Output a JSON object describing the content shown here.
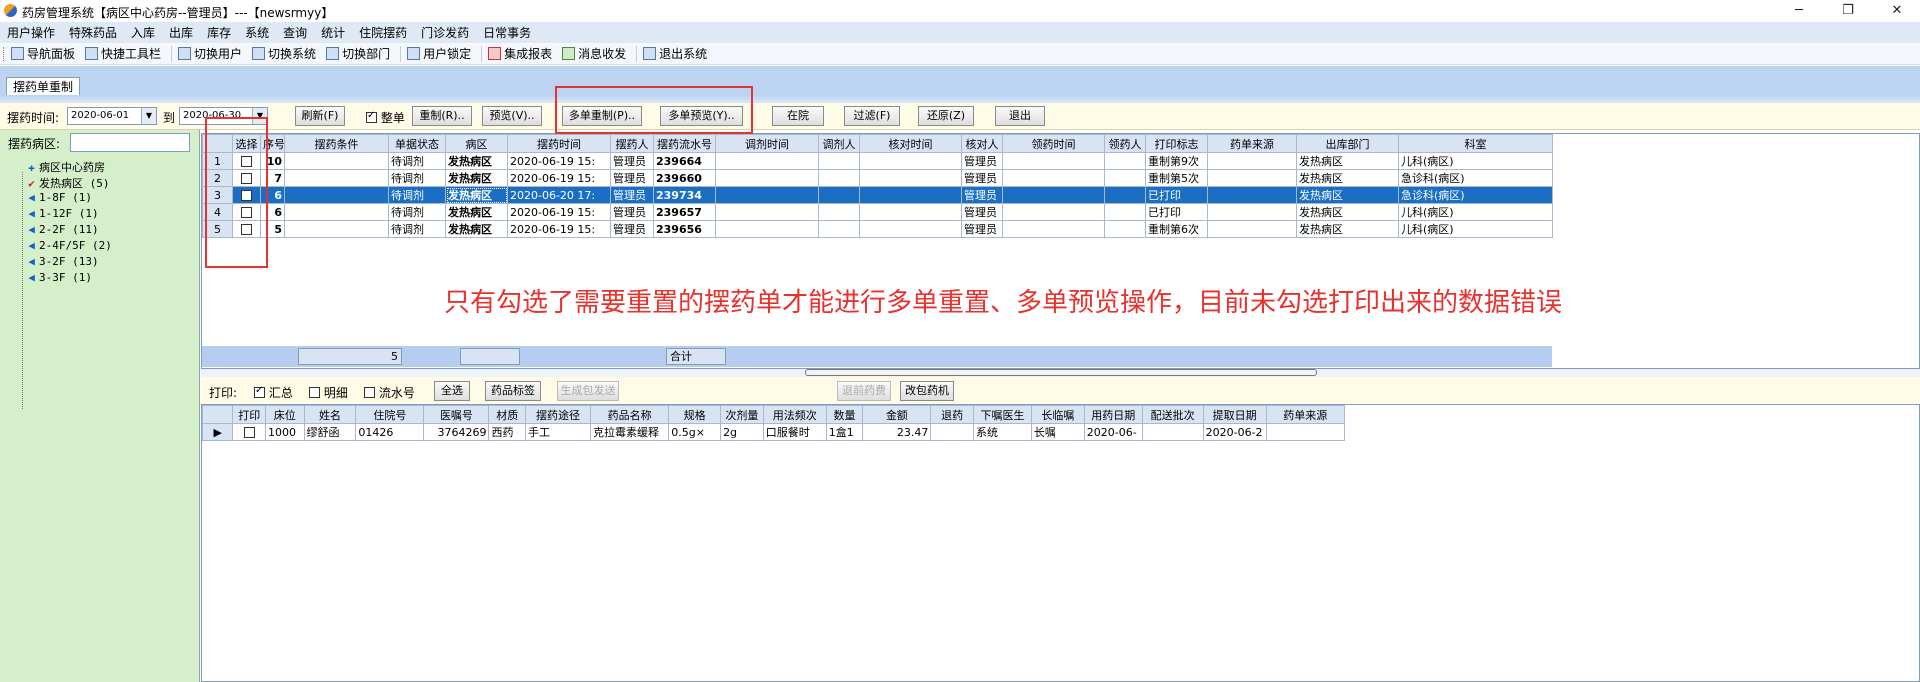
{
  "window": {
    "title": "药房管理系统【病区中心药房--管理员】---【newsrmyy】",
    "minimize": "─",
    "maximize": "❐",
    "close": "✕"
  },
  "menu": [
    "用户操作",
    "特殊药品",
    "入库",
    "出库",
    "库存",
    "系统",
    "查询",
    "统计",
    "住院摆药",
    "门诊发药",
    "日常事务"
  ],
  "toolbar": [
    {
      "label": "导航面板",
      "icon": "navigation-panel-icon"
    },
    {
      "label": "快捷工具栏",
      "icon": "quick-toolbar-icon"
    },
    {
      "label": "切换用户",
      "icon": "switch-user-icon"
    },
    {
      "label": "切换系统",
      "icon": "switch-system-icon"
    },
    {
      "label": "切换部门",
      "icon": "switch-department-icon"
    },
    {
      "label": "用户锁定",
      "icon": "user-lock-icon"
    },
    {
      "label": "集成报表",
      "icon": "report-icon"
    },
    {
      "label": "消息收发",
      "icon": "message-icon"
    },
    {
      "label": "退出系统",
      "icon": "exit-icon"
    }
  ],
  "tab": {
    "label": "摆药单重制"
  },
  "filter": {
    "time_label": "摆药时间:",
    "date_from": "2020-06-01",
    "to_label": "到",
    "date_to": "2020-06-30",
    "refresh": "刷新(F)",
    "whole_label": "整单",
    "whole_checked": true,
    "reset": "重制(R)..",
    "preview": "预览(V)..",
    "multi_reset": "多单重制(P)..",
    "multi_preview": "多单预览(Y)..",
    "in_hospital": "在院",
    "filter_btn": "过滤(F)",
    "restore": "还原(Z)",
    "exit": "退出",
    "ward_label": "摆药病区:"
  },
  "tree": [
    {
      "label": "病区中心药房",
      "icon": "cross-icon",
      "level": 0
    },
    {
      "label": "发热病区 (5)",
      "icon": "checkmark-icon",
      "level": 1
    },
    {
      "label": "1-8F (1)",
      "icon": "ward-icon",
      "level": 1
    },
    {
      "label": "1-12F (1)",
      "icon": "ward-icon",
      "level": 1
    },
    {
      "label": "2-2F (11)",
      "icon": "ward-icon",
      "level": 1
    },
    {
      "label": "2-4F/5F (2)",
      "icon": "ward-icon",
      "level": 1
    },
    {
      "label": "3-2F (13)",
      "icon": "ward-icon",
      "level": 1
    },
    {
      "label": "3-3F (1)",
      "icon": "ward-icon",
      "level": 1
    }
  ],
  "top_grid": {
    "columns": [
      "选择",
      "序号",
      "摆药条件",
      "单据状态",
      "病区",
      "摆药时间",
      "摆药人",
      "摆药流水号",
      "调剂时间",
      "调剂人",
      "核对时间",
      "核对人",
      "领药时间",
      "领药人",
      "打印标志",
      "药单来源",
      "出库部门",
      "科室"
    ],
    "rows": [
      {
        "rownum": "1",
        "seq": "10",
        "status": "待调剂",
        "ward": "发热病区",
        "time": "2020-06-19 15:",
        "person": "管理员",
        "serial": "239664",
        "checker": "管理员",
        "print": "重制第9次",
        "dept": "发热病区",
        "office": "儿科(病区)"
      },
      {
        "rownum": "2",
        "seq": "7",
        "status": "待调剂",
        "ward": "发热病区",
        "time": "2020-06-19 15:",
        "person": "管理员",
        "serial": "239660",
        "checker": "管理员",
        "print": "重制第5次",
        "dept": "发热病区",
        "office": "急诊科(病区)"
      },
      {
        "rownum": "3",
        "seq": "6",
        "status": "待调剂",
        "ward": "发热病区",
        "time": "2020-06-20 17:",
        "person": "管理员",
        "serial": "239734",
        "checker": "管理员",
        "print": "已打印",
        "dept": "发热病区",
        "office": "急诊科(病区)"
      },
      {
        "rownum": "4",
        "seq": "6",
        "status": "待调剂",
        "ward": "发热病区",
        "time": "2020-06-19 15:",
        "person": "管理员",
        "serial": "239657",
        "checker": "管理员",
        "print": "已打印",
        "dept": "发热病区",
        "office": "儿科(病区)"
      },
      {
        "rownum": "5",
        "seq": "5",
        "status": "待调剂",
        "ward": "发热病区",
        "time": "2020-06-19 15:",
        "person": "管理员",
        "serial": "239656",
        "checker": "管理员",
        "print": "重制第6次",
        "dept": "发热病区",
        "office": "儿科(病区)"
      }
    ],
    "footer_count": "5",
    "footer_total_label": "合计"
  },
  "annotation": "只有勾选了需要重置的摆药单才能进行多单重置、多单预览操作，目前未勾选打印出来的数据错误",
  "print_bar": {
    "label": "打印:",
    "summary": "汇总",
    "summary_checked": true,
    "detail": "明细",
    "serial": "流水号",
    "select_all": "全选",
    "drug_label": "药品标签",
    "gen_pack": "生成包发送",
    "return_drug": "退前药费",
    "change_machine": "改包药机"
  },
  "bottom_grid": {
    "columns": [
      "打印",
      "床位",
      "姓名",
      "住院号",
      "医嘱号",
      "材质",
      "摆药途径",
      "药品名称",
      "规格",
      "次剂量",
      "用法频次",
      "数量",
      "金额",
      "退药",
      "下嘱医生",
      "长临嘱",
      "用药日期",
      "配送批次",
      "提取日期",
      "药单来源"
    ],
    "rows": [
      {
        "bed": "1000",
        "name": "缪舒函",
        "inpatient": "01426",
        "order": "3764269",
        "material": "西药",
        "route": "手工",
        "drug": "克拉霉素缓释",
        "spec": "0.5g×",
        "dose": "2g",
        "freq": "口服餐时",
        "qty": "1盒1",
        "amount": "23.47",
        "doctor": "系统",
        "longtemp": "长嘱",
        "usedate": "2020-06-",
        "fetchdate": "2020-06-2"
      }
    ]
  }
}
